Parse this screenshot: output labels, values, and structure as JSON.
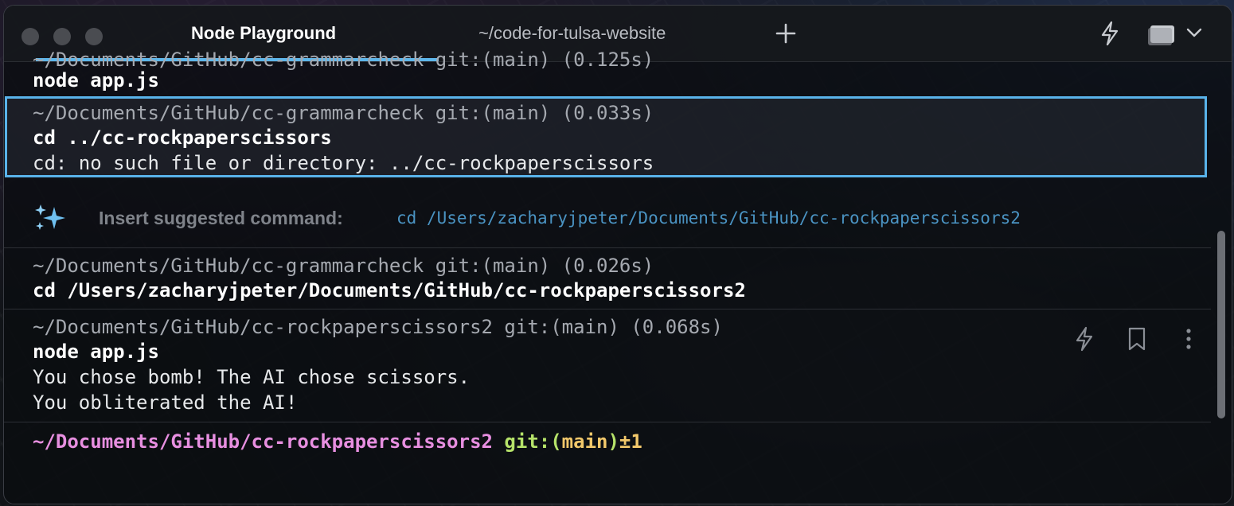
{
  "window": {
    "tabs": [
      {
        "label": "Node Playground",
        "active": true
      },
      {
        "label": "~/code-for-tulsa-website",
        "active": false
      }
    ],
    "new_tab_icon": "plus-icon",
    "right_icons": [
      "lightning-icon",
      "card-icon",
      "chevron-down-icon"
    ]
  },
  "blocks": [
    {
      "meta_partial": "~/Documents/GitHub/cc-grammarcheck git:(main) (0.125s)",
      "command": "node app.js"
    },
    {
      "meta": "~/Documents/GitHub/cc-grammarcheck git:(main) (0.033s)",
      "command": "cd ../cc-rockpaperscissors",
      "output": [
        "cd: no such file or directory: ../cc-rockpaperscissors"
      ]
    },
    {
      "meta": "~/Documents/GitHub/cc-grammarcheck git:(main) (0.026s)",
      "command": "cd /Users/zacharyjpeter/Documents/GitHub/cc-rockpaperscissors2"
    },
    {
      "meta": "~/Documents/GitHub/cc-rockpaperscissors2 git:(main) (0.068s)",
      "command": "node app.js",
      "output": [
        "You chose bomb! The AI chose scissors.",
        "You obliterated the AI!"
      ]
    }
  ],
  "suggestion": {
    "icon": "sparkles-icon",
    "label": "Insert suggested command:",
    "command": "cd /Users/zacharyjpeter/Documents/GitHub/cc-rockpaperscissors2"
  },
  "prompt": {
    "path": "~/Documents/GitHub/cc-rockpaperscissors2",
    "git": "git:(",
    "branch": "main",
    "git_close": ")",
    "status": "±1"
  },
  "colors": {
    "accent": "#59b3ea",
    "prompt_path": "#e78fe0",
    "prompt_git": "#b6e36a",
    "suggest_cmd": "#4a93c2"
  }
}
